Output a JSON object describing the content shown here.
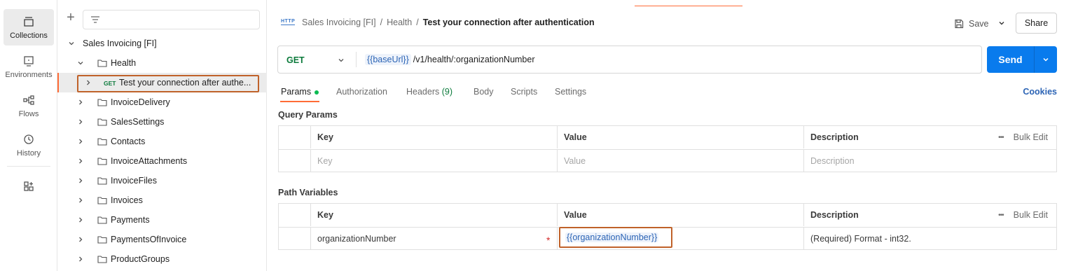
{
  "rail": {
    "items": [
      {
        "label": "Collections",
        "icon": "collections-icon",
        "active": true
      },
      {
        "label": "Environments",
        "icon": "environments-icon",
        "active": false
      },
      {
        "label": "Flows",
        "icon": "flows-icon",
        "active": false
      },
      {
        "label": "History",
        "icon": "history-icon",
        "active": false
      }
    ],
    "extra_icon": "add-workspace-icon"
  },
  "sidebar": {
    "collection": "Sales Invoicing [FI]",
    "folder_open": "Health",
    "request": {
      "method": "GET",
      "label": "Test your connection after authe..."
    },
    "folders": [
      "InvoiceDelivery",
      "SalesSettings",
      "Contacts",
      "InvoiceAttachments",
      "InvoiceFiles",
      "Invoices",
      "Payments",
      "PaymentsOfInvoice",
      "ProductGroups"
    ]
  },
  "header": {
    "http_icon": "HTTP",
    "breadcrumb": [
      "Sales Invoicing [FI]",
      "Health"
    ],
    "current": "Test your connection after authentication",
    "save_label": "Save",
    "share_label": "Share"
  },
  "request": {
    "method": "GET",
    "url_var": "{{baseUrl}}",
    "url_path": "/v1/health/:organizationNumber",
    "send_label": "Send"
  },
  "tabs": {
    "params": "Params",
    "authorization": "Authorization",
    "headers": "Headers",
    "headers_count": "(9)",
    "body": "Body",
    "scripts": "Scripts",
    "settings": "Settings",
    "cookies": "Cookies"
  },
  "query_params": {
    "title": "Query Params",
    "columns": {
      "key": "Key",
      "value": "Value",
      "description": "Description",
      "bulk": "Bulk Edit"
    },
    "placeholder": {
      "key": "Key",
      "value": "Value",
      "description": "Description"
    }
  },
  "path_variables": {
    "title": "Path Variables",
    "columns": {
      "key": "Key",
      "value": "Value",
      "description": "Description",
      "bulk": "Bulk Edit"
    },
    "rows": [
      {
        "key": "organizationNumber",
        "required": "*",
        "value": "{{organizationNumber}}",
        "description": "(Required) Format - int32."
      }
    ]
  },
  "colors": {
    "accent": "#ff6c37",
    "send": "#097bed",
    "get": "#0b7a3b",
    "var": "#2c64b5"
  }
}
